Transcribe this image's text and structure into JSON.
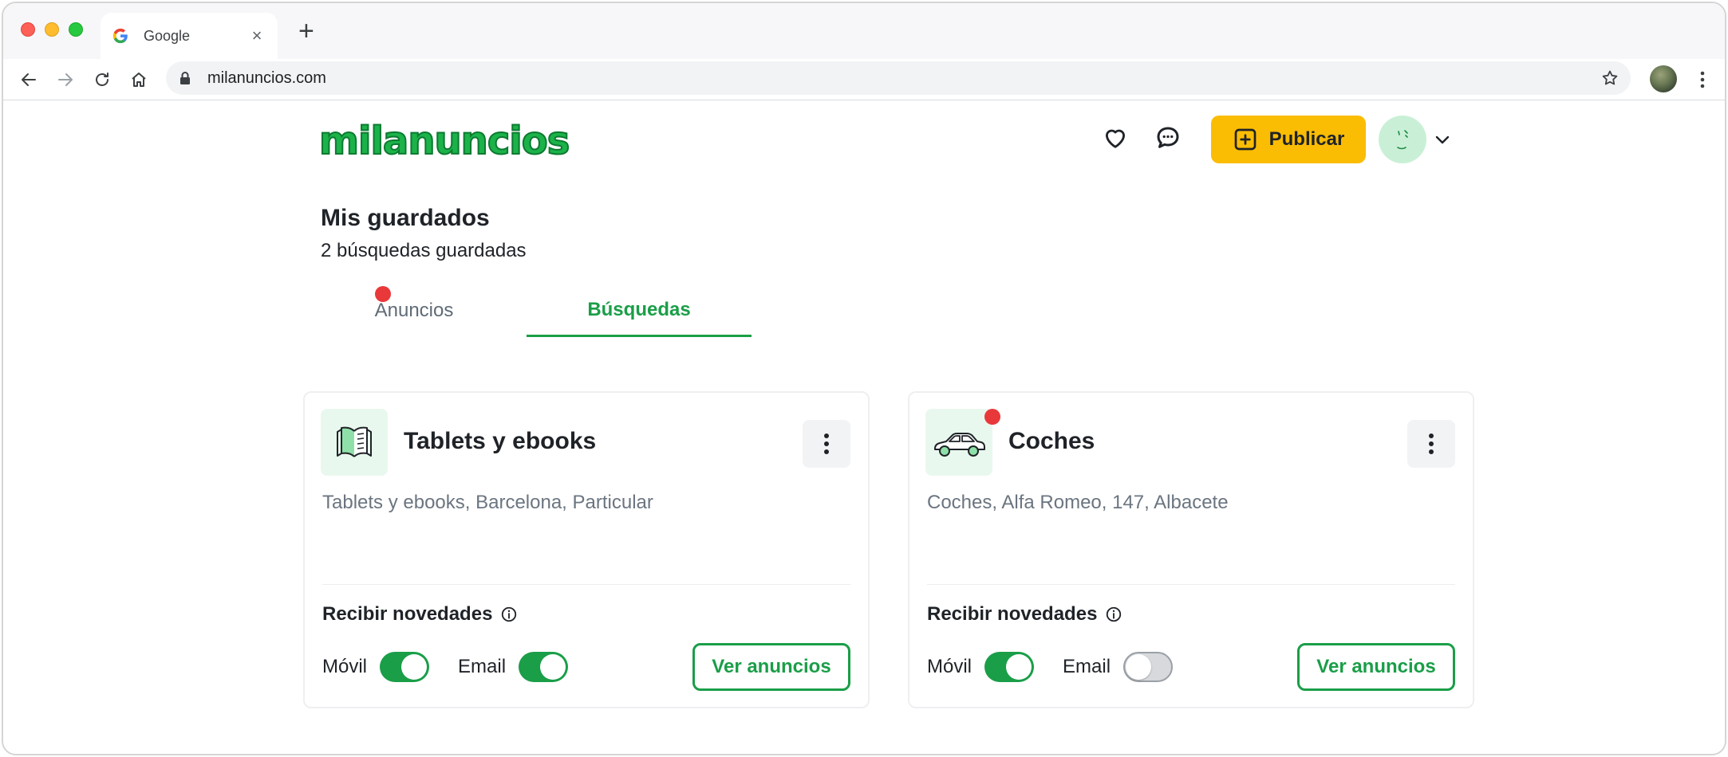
{
  "browser": {
    "tab_title": "Google",
    "tab_close": "×",
    "new_tab": "+",
    "url": "milanuncios.com"
  },
  "header": {
    "logo_text": "milanuncios",
    "publish_label": "Publicar"
  },
  "page": {
    "title": "Mis guardados",
    "subtitle": "2 búsquedas guardadas"
  },
  "tabs": [
    {
      "label": "Anuncios",
      "active": false
    },
    {
      "label": "Búsquedas",
      "active": true,
      "has_notification": true
    }
  ],
  "cards": [
    {
      "title": "Tablets y ebooks",
      "icon": "book-icon",
      "description": "Tablets y ebooks, Barcelona, Particular",
      "notifications_label": "Recibir novedades",
      "mobile_label": "Móvil",
      "mobile_enabled": true,
      "email_label": "Email",
      "email_enabled": true,
      "cta_label": "Ver anuncios",
      "has_notification": false
    },
    {
      "title": "Coches",
      "icon": "car-icon",
      "description": "Coches, Alfa Romeo, 147, Albacete",
      "notifications_label": "Recibir novedades",
      "mobile_label": "Móvil",
      "mobile_enabled": true,
      "email_label": "Email",
      "email_enabled": false,
      "cta_label": "Ver anuncios",
      "has_notification": true
    }
  ],
  "colors": {
    "brand_green": "#1a9e48",
    "publish_yellow": "#fbbc04",
    "notification_red": "#e9383a"
  }
}
